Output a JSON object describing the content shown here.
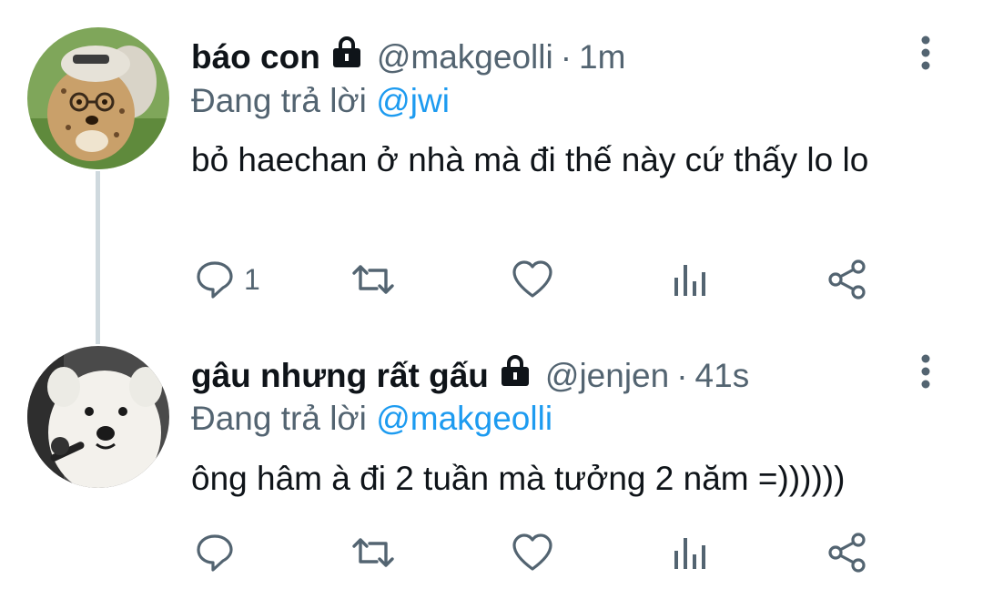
{
  "tweets": [
    {
      "display_name": "báo con",
      "handle": "@makgeolli",
      "separator": "·",
      "time": "1m",
      "reply_prefix": "Đang trả lời",
      "reply_to": "@jwi",
      "text": "bỏ haechan ở nhà mà đi thế này cứ thấy lo lo",
      "actions": {
        "reply_count": "1",
        "retweet_count": "",
        "like_count": ""
      },
      "avatar_icon": "cheetah-cub-avatar",
      "lock_icon": "lock-icon"
    },
    {
      "display_name": "gâu nhưng rất gấu",
      "handle": "@jenjen",
      "separator": "·",
      "time": "41s",
      "reply_prefix": "Đang trả lời",
      "reply_to": "@makgeolli",
      "text": "ông hâm à đi 2 tuần mà tưởng 2 năm =))))))",
      "actions": {
        "reply_count": "",
        "retweet_count": "",
        "like_count": ""
      },
      "avatar_icon": "samoyed-dog-avatar",
      "lock_icon": "lock-icon"
    }
  ],
  "colors": {
    "text": "#0f1419",
    "secondary": "#536471",
    "accent": "#1d9bf0",
    "thread_line": "#cfd9de"
  }
}
